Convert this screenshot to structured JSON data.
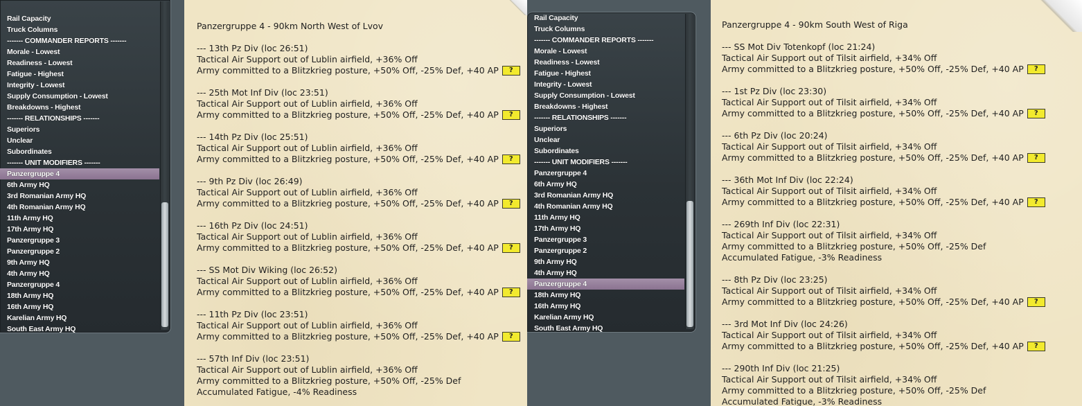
{
  "left": {
    "menu": [
      {
        "label": "Rail Capacity"
      },
      {
        "label": "Truck Columns"
      },
      {
        "label": "------- COMMANDER REPORTS -------"
      },
      {
        "label": "Morale - Lowest"
      },
      {
        "label": "Readiness - Lowest"
      },
      {
        "label": "Fatigue - Highest"
      },
      {
        "label": "Integrity - Lowest"
      },
      {
        "label": "Supply Consumption - Lowest"
      },
      {
        "label": "Breakdowns - Highest"
      },
      {
        "label": "------- RELATIONSHIPS -------"
      },
      {
        "label": "Superiors"
      },
      {
        "label": "Unclear"
      },
      {
        "label": "Subordinates"
      },
      {
        "label": "------- UNIT MODIFIERS -------"
      },
      {
        "label": "Panzergruppe 4"
      },
      {
        "label": "6th Army HQ"
      },
      {
        "label": "3rd Romanian Army HQ"
      },
      {
        "label": "4th Romanian Army HQ"
      },
      {
        "label": "11th Army HQ"
      },
      {
        "label": "17th Army HQ"
      },
      {
        "label": "Panzergruppe 3"
      },
      {
        "label": "Panzergruppe 2"
      },
      {
        "label": "9th Army HQ"
      },
      {
        "label": "4th Army HQ"
      },
      {
        "label": "Panzergruppe 4"
      },
      {
        "label": "18th Army HQ"
      },
      {
        "label": "16th Army HQ"
      },
      {
        "label": "Karelian Army HQ"
      },
      {
        "label": "South East Army HQ"
      }
    ],
    "report": {
      "title": "Panzergruppe 4 - 90km North West of Lvov",
      "entries": [
        {
          "header": "--- 13th Pz Div (loc 26:51)",
          "lines": [
            "Tactical Air Support out of Lublin airfield, +36% Off",
            "Army committed to a Blitzkrieg posture, +50% Off, -25% Def, +40 AP"
          ]
        },
        {
          "header": "--- 25th Mot Inf Div (loc 23:51)",
          "lines": [
            "Tactical Air Support out of Lublin airfield, +36% Off",
            "Army committed to a Blitzkrieg posture, +50% Off, -25% Def, +40 AP"
          ]
        },
        {
          "header": "--- 14th Pz Div (loc 25:51)",
          "lines": [
            "Tactical Air Support out of Lublin airfield, +36% Off",
            "Army committed to a Blitzkrieg posture, +50% Off, -25% Def, +40 AP"
          ]
        },
        {
          "header": "--- 9th Pz Div (loc 26:49)",
          "lines": [
            "Tactical Air Support out of Lublin airfield, +36% Off",
            "Army committed to a Blitzkrieg posture, +50% Off, -25% Def, +40 AP"
          ]
        },
        {
          "header": "--- 16th Pz Div (loc 24:51)",
          "lines": [
            "Tactical Air Support out of Lublin airfield, +36% Off",
            "Army committed to a Blitzkrieg posture, +50% Off, -25% Def, +40 AP"
          ]
        },
        {
          "header": "--- SS Mot Div Wiking (loc 26:52)",
          "lines": [
            "Tactical Air Support out of Lublin airfield, +36% Off",
            "Army committed to a Blitzkrieg posture, +50% Off, -25% Def, +40 AP"
          ]
        },
        {
          "header": "--- 11th Pz Div (loc 23:51)",
          "lines": [
            "Tactical Air Support out of Lublin airfield, +36% Off",
            "Army committed to a Blitzkrieg posture, +50% Off, -25% Def, +40 AP"
          ]
        },
        {
          "header": "--- 57th Inf Div (loc 23:51)",
          "lines": [
            "Tactical Air Support out of Lublin airfield, +36% Off",
            "Army committed to a Blitzkrieg posture, +50% Off, -25% Def",
            "Accumulated Fatigue, -4% Readiness"
          ]
        }
      ]
    }
  },
  "right": {
    "menu": [
      {
        "label": "Rail Capacity"
      },
      {
        "label": "Truck Columns"
      },
      {
        "label": "------- COMMANDER REPORTS -------"
      },
      {
        "label": "Morale - Lowest"
      },
      {
        "label": "Readiness - Lowest"
      },
      {
        "label": "Fatigue - Highest"
      },
      {
        "label": "Integrity - Lowest"
      },
      {
        "label": "Supply Consumption - Lowest"
      },
      {
        "label": "Breakdowns - Highest"
      },
      {
        "label": "------- RELATIONSHIPS -------"
      },
      {
        "label": "Superiors"
      },
      {
        "label": "Unclear"
      },
      {
        "label": "Subordinates"
      },
      {
        "label": "------- UNIT MODIFIERS -------"
      },
      {
        "label": "Panzergruppe 4"
      },
      {
        "label": "6th Army HQ"
      },
      {
        "label": "3rd Romanian Army HQ"
      },
      {
        "label": "4th Romanian Army HQ"
      },
      {
        "label": "11th Army HQ"
      },
      {
        "label": "17th Army HQ"
      },
      {
        "label": "Panzergruppe 3"
      },
      {
        "label": "Panzergruppe 2"
      },
      {
        "label": "9th Army HQ"
      },
      {
        "label": "4th Army HQ"
      },
      {
        "label": "Panzergruppe 4"
      },
      {
        "label": "18th Army HQ"
      },
      {
        "label": "16th Army HQ"
      },
      {
        "label": "Karelian Army HQ"
      },
      {
        "label": "South East Army HQ"
      }
    ],
    "report": {
      "title": "Panzergruppe 4 - 90km South West of Riga",
      "entries": [
        {
          "header": "--- SS Mot Div Totenkopf (loc 21:24)",
          "lines": [
            "Tactical Air Support out of Tilsit airfield, +34% Off",
            "Army committed to a Blitzkrieg posture, +50% Off, -25% Def, +40 AP"
          ]
        },
        {
          "header": "--- 1st Pz Div (loc 23:30)",
          "lines": [
            "Tactical Air Support out of Tilsit airfield, +34% Off",
            "Army committed to a Blitzkrieg posture, +50% Off, -25% Def, +40 AP"
          ]
        },
        {
          "header": "--- 6th Pz Div (loc 20:24)",
          "lines": [
            "Tactical Air Support out of Tilsit airfield, +34% Off",
            "Army committed to a Blitzkrieg posture, +50% Off, -25% Def, +40 AP"
          ]
        },
        {
          "header": "--- 36th Mot Inf Div (loc 22:24)",
          "lines": [
            "Tactical Air Support out of Tilsit airfield, +34% Off",
            "Army committed to a Blitzkrieg posture, +50% Off, -25% Def, +40 AP"
          ]
        },
        {
          "header": "--- 269th Inf Div (loc 22:31)",
          "lines": [
            "Tactical Air Support out of Tilsit airfield, +34% Off",
            "Army committed to a Blitzkrieg posture, +50% Off, -25% Def",
            "Accumulated Fatigue, -3% Readiness"
          ]
        },
        {
          "header": "--- 8th Pz Div (loc 23:25)",
          "lines": [
            "Tactical Air Support out of Tilsit airfield, +34% Off",
            "Army committed to a Blitzkrieg posture, +50% Off, -25% Def, +40 AP"
          ]
        },
        {
          "header": "--- 3rd Mot Inf Div (loc 24:26)",
          "lines": [
            "Tactical Air Support out of Tilsit airfield, +34% Off",
            "Army committed to a Blitzkrieg posture, +50% Off, -25% Def, +40 AP"
          ]
        },
        {
          "header": "--- 290th Inf Div (loc 21:25)",
          "lines": [
            "Tactical Air Support out of Tilsit airfield, +34% Off",
            "Army committed to a Blitzkrieg posture, +50% Off, -25% Def",
            "Accumulated Fatigue, -3% Readiness"
          ]
        }
      ]
    }
  },
  "help_button_label": "?",
  "colors": {
    "panel_bg": "#2b3236",
    "selected_item": "#9a83a0",
    "paper": "#f0e5c5",
    "help_box": "#f2ea2e"
  }
}
